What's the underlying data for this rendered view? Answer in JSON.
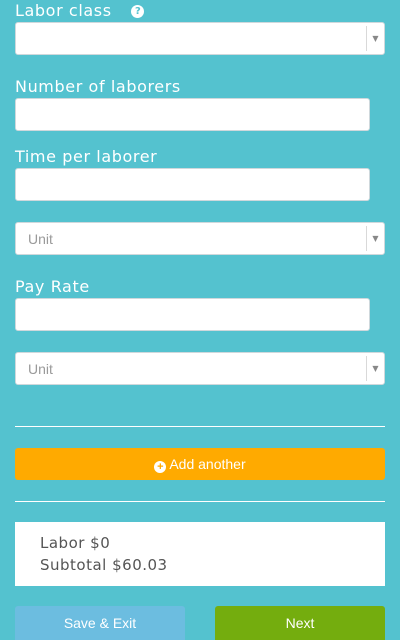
{
  "form": {
    "labor_class": {
      "label": "Labor class",
      "value": ""
    },
    "number_of_laborers": {
      "label": "Number of laborers",
      "value": ""
    },
    "time_per_laborer": {
      "label": "Time per laborer",
      "value": "",
      "unit_placeholder": "Unit"
    },
    "pay_rate": {
      "label": "Pay Rate",
      "value": "",
      "unit_placeholder": "Unit"
    }
  },
  "actions": {
    "add_another": "Add another",
    "save_exit": "Save & Exit",
    "next": "Next"
  },
  "summary": {
    "labor": "Labor $0",
    "subtotal": "Subtotal $60.03"
  },
  "icons": {
    "help": "question-circle-icon",
    "add": "plus-circle-icon",
    "dropdown": "caret-down-icon"
  },
  "colors": {
    "background": "#54c2cf",
    "add_button": "#ffaa00",
    "save_button": "#6cbde0",
    "next_button": "#74ad0e"
  }
}
